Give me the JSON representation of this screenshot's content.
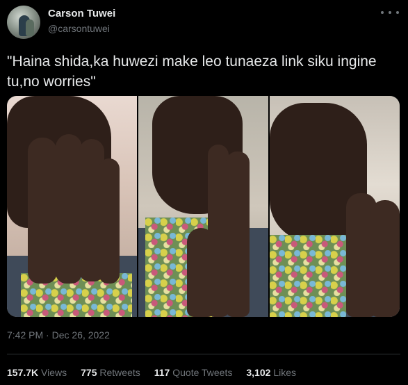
{
  "author": {
    "display_name": "Carson Tuwei",
    "handle": "@carsontuwei"
  },
  "tweet": {
    "text": "\"Haina shida,ka huwezi make leo tunaeza link siku ingine tu,no worries\"",
    "timestamp": "7:42 PM · Dec 26, 2022"
  },
  "media": {
    "panel_count": 3
  },
  "stats": {
    "views_count": "157.7K",
    "views_label": "Views",
    "retweets_count": "775",
    "retweets_label": "Retweets",
    "quotes_count": "117",
    "quotes_label": "Quote Tweets",
    "likes_count": "3,102",
    "likes_label": "Likes"
  },
  "icons": {
    "more": "more-horizontal-icon"
  },
  "colors": {
    "background": "#000000",
    "primary_text": "#e7e9ea",
    "secondary_text": "#71767b",
    "divider": "#2f3336"
  }
}
